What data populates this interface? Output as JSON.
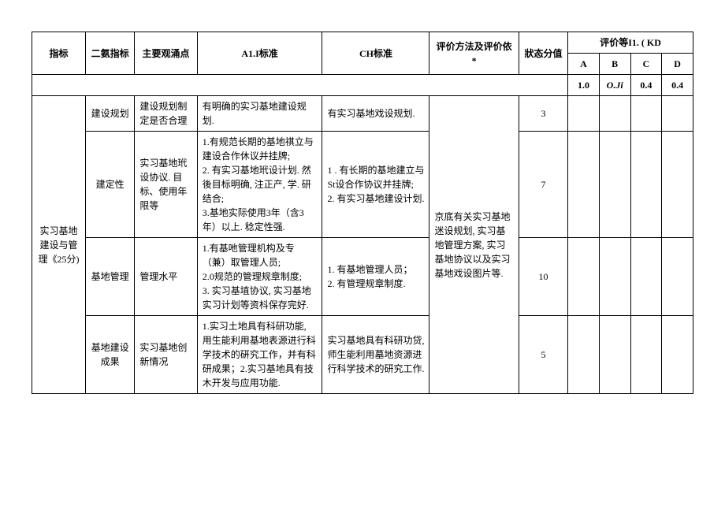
{
  "headers": {
    "indicator": "指标",
    "sub": "二氨指标",
    "point": "主要观涌点",
    "a1": "A1.I标准",
    "ch": "CH标准",
    "eval": "评价方法及评价依*",
    "score": "狀态分值",
    "grade_group": "评价等I1. ( KD",
    "ga": "A",
    "gb": "B",
    "gc": "C",
    "gd": "D",
    "va": "1.0",
    "vb": "O.Ji",
    "vc": "0.4",
    "vd": "0.4"
  },
  "group": {
    "indicator": "实习基地建设与管理《25分)",
    "eval": "京底有关实习基地迷设规划, 实习基地管理方案, 实习基地协议以及实习基地戏设图片等."
  },
  "rows": [
    {
      "sub": "建设规划",
      "point": "建设规划制定是否合理",
      "a1": "有明确的实习基地建设规划.",
      "ch": "有实习基地戏设规划.",
      "score": "3"
    },
    {
      "sub": "建定性",
      "point": "实习基地玳设协议. 目标、使用年限等",
      "a1": "1.有规范长期的基地祺立与建设合作休议并挂牌;\n2. 有实习基地玳设计划. 然後目标明确, 注正产, 学. 研结合;\n3.基地实际使用3年（含3年）以上. 稔定性强.",
      "ch": "1    . 有长期的基地建立与St设合作协议并挂牌;\n2. 有实习基地建设计划.",
      "score": "7"
    },
    {
      "sub": "基地管理",
      "point": "管理水平",
      "a1": "1.有基吔管理机构及专（兼）取管理人员;\n2.0规范的管理规章制度;\n3. 实习基埴协议, 实习基地实习计划等资枓保存完好.",
      "ch": "1. 有基地管理人员；\n2. 有管理规章制度.",
      "score": "10"
    },
    {
      "sub": "基地建设成果",
      "point": "实习基地创新情况",
      "a1": "1.实习土地具有科研功能, 用生能利用基地表源进行科学技术的硏究工作，并有科研成果；2.实习基地具有技木开发与应用功能.",
      "ch": "实习基地具有科研功贷, 师生能利用墓地资源进行科学技术的研究工作.",
      "score": "5"
    }
  ]
}
